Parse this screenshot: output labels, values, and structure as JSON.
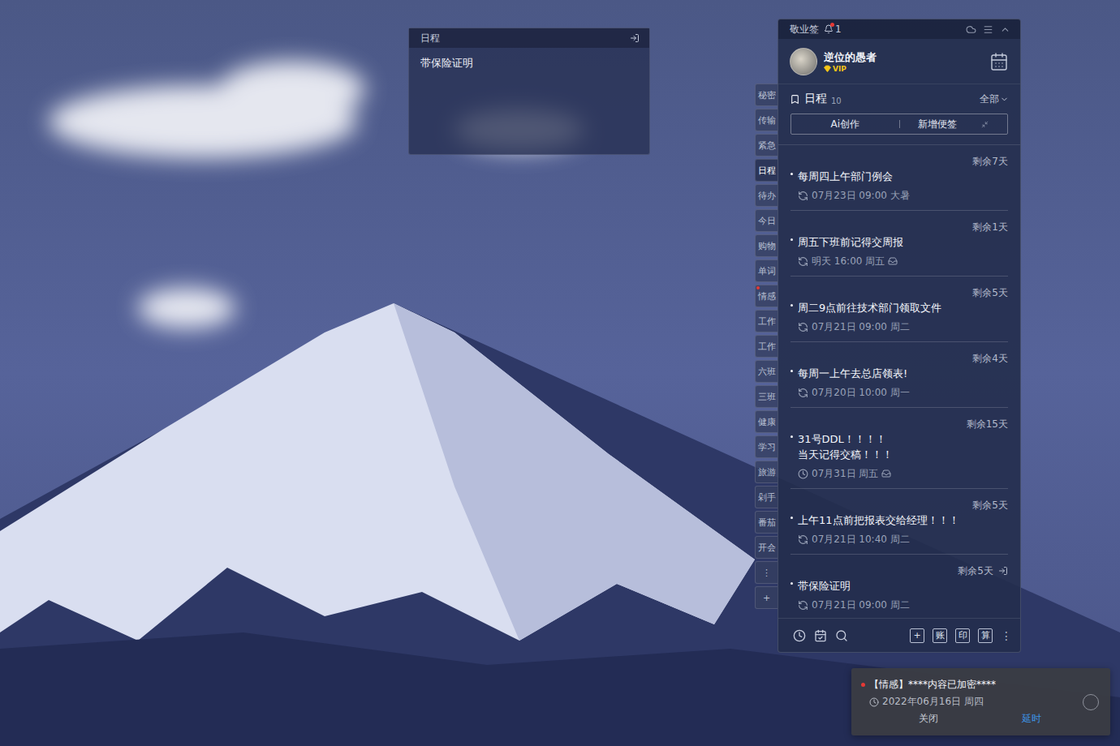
{
  "sticky_window": {
    "title": "日程",
    "content": "带保险证明"
  },
  "app": {
    "title": "敬业签",
    "notification_count": "1",
    "user": {
      "name": "逆位的愚者",
      "badge": "VIP"
    },
    "section": {
      "title": "日程",
      "count": "10",
      "filter": "全部"
    },
    "actions": [
      "Ai创作",
      "新增便签"
    ],
    "side_tabs": [
      {
        "label": "秘密",
        "selected": false,
        "unread": false
      },
      {
        "label": "传输",
        "selected": false,
        "unread": false
      },
      {
        "label": "紧急",
        "selected": false,
        "unread": false
      },
      {
        "label": "日程",
        "selected": true,
        "unread": false
      },
      {
        "label": "待办",
        "selected": false,
        "unread": false
      },
      {
        "label": "今日",
        "selected": false,
        "unread": false
      },
      {
        "label": "购物",
        "selected": false,
        "unread": false
      },
      {
        "label": "单词",
        "selected": false,
        "unread": false
      },
      {
        "label": "情感",
        "selected": false,
        "unread": true
      },
      {
        "label": "工作",
        "selected": false,
        "unread": false
      },
      {
        "label": "工作",
        "selected": false,
        "unread": false
      },
      {
        "label": "六班",
        "selected": false,
        "unread": false
      },
      {
        "label": "三班",
        "selected": false,
        "unread": false
      },
      {
        "label": "健康",
        "selected": false,
        "unread": false
      },
      {
        "label": "学习",
        "selected": false,
        "unread": false
      },
      {
        "label": "旅游",
        "selected": false,
        "unread": false
      },
      {
        "label": "剁手",
        "selected": false,
        "unread": false
      },
      {
        "label": "番茄",
        "selected": false,
        "unread": false
      },
      {
        "label": "开会",
        "selected": false,
        "unread": false
      }
    ],
    "side_more": "⋮",
    "side_add": "+",
    "items": [
      {
        "remaining": "剩余7天",
        "lines": [
          "每周四上午部门例会"
        ],
        "date": "07月23日 09:00 大暑",
        "kind": "repeat",
        "attachment": false,
        "on_desktop": false
      },
      {
        "remaining": "剩余1天",
        "lines": [
          "周五下班前记得交周报"
        ],
        "date": "明天 16:00 周五",
        "kind": "repeat",
        "attachment": true,
        "on_desktop": false
      },
      {
        "remaining": "剩余5天",
        "lines": [
          "周二9点前往技术部门领取文件"
        ],
        "date": "07月21日 09:00 周二",
        "kind": "repeat",
        "attachment": false,
        "on_desktop": false
      },
      {
        "remaining": "剩余4天",
        "lines": [
          "每周一上午去总店领表!"
        ],
        "date": "07月20日 10:00 周一",
        "kind": "repeat",
        "attachment": false,
        "on_desktop": false
      },
      {
        "remaining": "剩余15天",
        "lines": [
          "31号DDL！！！！",
          "当天记得交稿！！！"
        ],
        "date": "07月31日 周五",
        "kind": "once",
        "attachment": true,
        "on_desktop": false
      },
      {
        "remaining": "剩余5天",
        "lines": [
          "上午11点前把报表交给经理！！！"
        ],
        "date": "07月21日 10:40 周二",
        "kind": "repeat",
        "attachment": false,
        "on_desktop": false
      },
      {
        "remaining": "剩余5天",
        "lines": [
          "带保险证明"
        ],
        "date": "07月21日 09:00 周二",
        "kind": "repeat",
        "attachment": false,
        "on_desktop": true
      }
    ],
    "footer": {
      "tools": [
        "+",
        "账",
        "印",
        "算"
      ],
      "more": "⋮"
    }
  },
  "notification": {
    "text": "【情感】****内容已加密****",
    "unread": true,
    "time": "2022年06月16日 周四",
    "buttons": [
      "关闭",
      "延时"
    ]
  }
}
